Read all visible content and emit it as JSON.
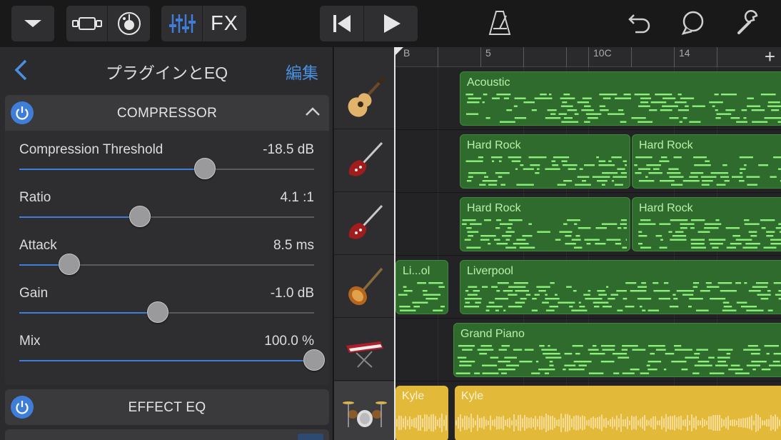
{
  "toolbar": {
    "fx_label": "FX"
  },
  "panel": {
    "title": "プラグインとEQ",
    "edit_label": "編集",
    "compressor": {
      "title": "COMPRESSOR",
      "params": [
        {
          "label": "Compression Threshold",
          "value": "-18.5 dB",
          "level": 0.63
        },
        {
          "label": "Ratio",
          "value": "4.1 :1",
          "level": 0.41
        },
        {
          "label": "Attack",
          "value": "8.5 ms",
          "level": 0.17
        },
        {
          "label": "Gain",
          "value": "-1.0 dB",
          "level": 0.47
        },
        {
          "label": "Mix",
          "value": "100.0 %",
          "level": 1.0
        }
      ]
    },
    "effect_eq": {
      "title": "EFFECT EQ"
    }
  },
  "ruler": {
    "marks": [
      "B",
      "5",
      "10C",
      "14"
    ],
    "add_label": "+"
  },
  "tracks": [
    {
      "icon": "acoustic-guitar-icon",
      "regions": [
        {
          "name": "Acoustic",
          "color": "green"
        }
      ]
    },
    {
      "icon": "electric-guitar-icon",
      "regions": [
        {
          "name": "Hard Rock",
          "color": "green"
        },
        {
          "name": "Hard Rock",
          "color": "green"
        }
      ]
    },
    {
      "icon": "electric-guitar-icon",
      "regions": [
        {
          "name": "Hard Rock",
          "color": "green"
        },
        {
          "name": "Hard Rock",
          "color": "green"
        }
      ]
    },
    {
      "icon": "bass-guitar-icon",
      "regions": [
        {
          "name": "Li...ol",
          "color": "green"
        },
        {
          "name": "Liverpool",
          "color": "green"
        }
      ]
    },
    {
      "icon": "keyboard-icon",
      "regions": [
        {
          "name": "Grand Piano",
          "color": "green"
        }
      ]
    },
    {
      "icon": "drum-kit-icon",
      "regions": [
        {
          "name": "Kyle",
          "color": "yellow"
        },
        {
          "name": "Kyle",
          "color": "yellow"
        }
      ]
    }
  ],
  "colors": {
    "accent": "#3f7ed8",
    "region_green": "#2f6b2d",
    "region_note": "#8cf07a",
    "region_yellow": "#e3b93a"
  }
}
